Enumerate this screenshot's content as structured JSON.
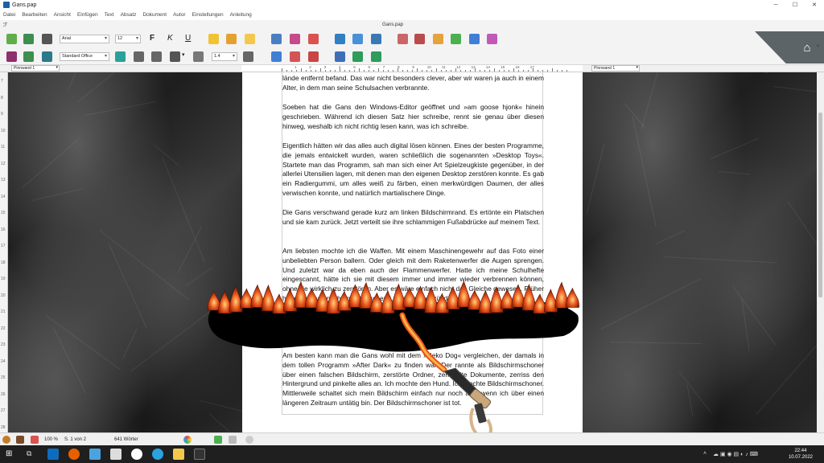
{
  "window": {
    "title": "Gans.pap"
  },
  "menu": [
    "Datei",
    "Bearbeiten",
    "Ansicht",
    "Einfügen",
    "Text",
    "Absatz",
    "Dokument",
    "Autor",
    "Einstellungen",
    "Anleitung"
  ],
  "toolbar": {
    "doc_tab": "Gans.pap",
    "font": "Arial",
    "size": "12",
    "style": "Standard Office",
    "line_spacing": "1.4",
    "bold": "F",
    "italic": "K",
    "underline": "U"
  },
  "pinnwand": {
    "left": "Pinnwand 1",
    "right": "Pinnwand 1"
  },
  "ruler_numbers": [
    "1",
    "2",
    "3",
    "4",
    "5",
    "6",
    "7",
    "8",
    "9",
    "10",
    "11",
    "12",
    "13",
    "14",
    "15",
    "16",
    "17"
  ],
  "line_numbers": [
    "7",
    "8",
    "9",
    "10",
    "11",
    "12",
    "13",
    "14",
    "15",
    "16",
    "17",
    "18",
    "19",
    "20",
    "21",
    "22",
    "23",
    "24",
    "25",
    "26",
    "27",
    "28"
  ],
  "paragraphs": [
    "lände entfernt befand. Das war nicht besonders clever, aber wir waren ja auch in einem Alter, in dem man seine Schulsachen verbrannte.",
    "Soeben hat die Gans den Windows-Editor geöffnet und »am goose hjonk« hinein geschrieben. Während ich diesen Satz hier schreibe, rennt sie genau über diesen hinweg, weshalb ich nicht richtig lesen kann, was ich schreibe.",
    "Eigentlich hätten wir das alles auch digital lösen können. Eines der besten Programme, die jemals entwickelt wurden, waren schließlich die sogenannten »Desktop Toys«. Startete man das Programm, sah man sich einer Art Spielzeugkiste gegenüber, in der allerlei Utensilien lagen, mit denen man den eigenen Desktop zerstören konnte. Es gab ein Radiergummi, um alles weiß zu färben, einen merkwürdigen Daumen, der alles verwischen konnte, und natürlich martialischere Dinge.",
    "Die Gans verschwand gerade kurz am linken Bildschirmrand. Es ertönte ein Platschen und sie kam zurück. Jetzt verteilt sie ihre schlammigen Fußabdrücke auf meinem Text.",
    "Am liebsten mochte ich die Waffen. Mit einem Maschinengewehr auf das Foto einer unbeliebten Person ballern. Oder gleich mit dem Raketenwerfer die Augen sprengen. Und zuletzt war da eben auch der Flammenwerfer. Hatte ich meine Schulhefte eingescannt, hätte ich sie mit diesem immer und immer wieder verbrennen können, ohne sie wirklich zu zerstören. Aber es wäre einfach nicht das Gleiche gewesen. Früher haben wir halt noch an der frischen Luft alles angezündet.",
    "Am besten kann man die Gans wohl mit dem »Neko Dog« vergleichen, der damals in dem tollen Programm »After Dark« zu finden war. Der rannte als Bildschirmschoner über einen falschen Bildschirm, zerstörte Ordner, zerknüllte Dokumente, zerriss den Hintergrund und pinkelte alles an. Ich mochte den Hund. Ich mochte Bildschirmschoner. Mittlerweile schaltet sich mein Bildschirm einfach nur noch aus, wenn ich über einen längeren Zeitraum untätig bin. Der Bildschirmschoner ist tot."
  ],
  "status": {
    "zoom": "100 %",
    "page": "S. 1 von 2",
    "words": "641 Wörter"
  },
  "clock": {
    "time": "22:44",
    "date": "10.07.2022"
  },
  "colors": {
    "flame": "#e8531a",
    "toolbar_bg": "#f3f3f3",
    "taskbar": "#1f1f1f"
  }
}
